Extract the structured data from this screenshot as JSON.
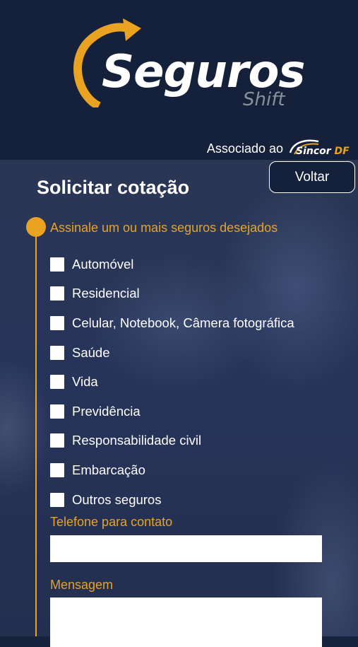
{
  "brand": {
    "name": "Seguros",
    "subname": "Shift",
    "accent_color": "#e9a320",
    "header_color": "#15203b"
  },
  "association": {
    "text": "Associado ao",
    "partner_name": "Sincor",
    "partner_suffix": "DF"
  },
  "navigation": {
    "back_label": "Voltar"
  },
  "form": {
    "title": "Solicitar cotação",
    "insurance_section_label": "Assinale um ou mais seguros desejados",
    "options": [
      {
        "label": "Automóvel",
        "checked": false
      },
      {
        "label": "Residencial",
        "checked": false
      },
      {
        "label": "Celular, Notebook, Câmera fotográfica",
        "checked": false
      },
      {
        "label": "Saúde",
        "checked": false
      },
      {
        "label": "Vida",
        "checked": false
      },
      {
        "label": "Previdência",
        "checked": false
      },
      {
        "label": "Responsabilidade civil",
        "checked": false
      },
      {
        "label": "Embarcação",
        "checked": false
      },
      {
        "label": "Outros seguros",
        "checked": false
      }
    ],
    "phone_label": "Telefone para contato",
    "phone_value": "",
    "message_label": "Mensagem",
    "message_value": ""
  }
}
